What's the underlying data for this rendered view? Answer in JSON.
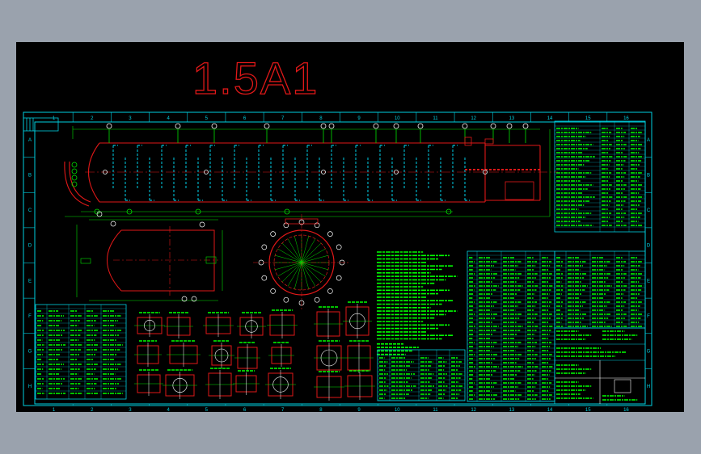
{
  "drawing": {
    "title": "1.5A1"
  },
  "colors": {
    "frame_bg": "#9aa2ad",
    "model_bg": "#000000",
    "border": "#00d0e0",
    "title_red": "#e01818",
    "vessel_red": "#e01818",
    "dim_green": "#00e000",
    "text_green": "#00ff00",
    "cyan": "#00e5ff",
    "white": "#ffffff",
    "yellow": "#ffff00"
  },
  "border_zones": {
    "columns": [
      "1",
      "2",
      "3",
      "4",
      "5",
      "6",
      "7",
      "8",
      "9",
      "10",
      "11",
      "12",
      "13",
      "14",
      "15",
      "16"
    ],
    "rows": [
      "A",
      "B",
      "C",
      "D",
      "E",
      "F",
      "G",
      "H"
    ]
  }
}
